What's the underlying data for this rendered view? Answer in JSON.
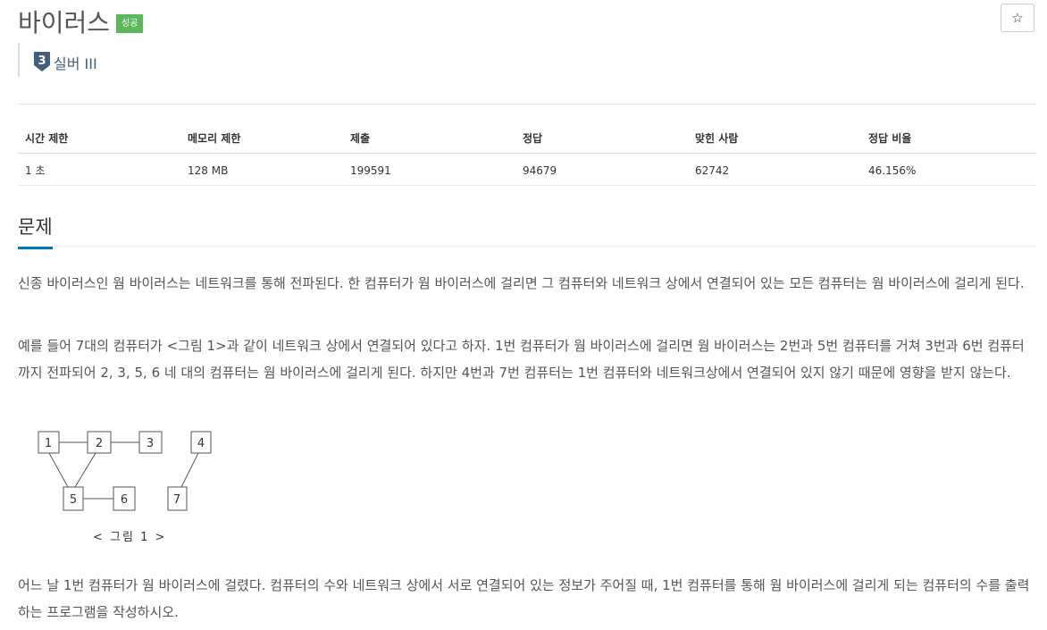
{
  "problem": {
    "title": "바이러스",
    "badge": "성공",
    "star": "☆",
    "tier_number": "3",
    "tier_label": "실버 III"
  },
  "info_table": {
    "headers": [
      "시간 제한",
      "메모리 제한",
      "제출",
      "정답",
      "맞힌 사람",
      "정답 비율"
    ],
    "values": [
      "1 초",
      "128 MB",
      "199591",
      "94679",
      "62742",
      "46.156%"
    ]
  },
  "section": {
    "title": "문제"
  },
  "paragraphs": [
    "신종 바이러스인 웜 바이러스는 네트워크를 통해 전파된다. 한 컴퓨터가 웜 바이러스에 걸리면 그 컴퓨터와 네트워크 상에서 연결되어 있는 모든 컴퓨터는 웜 바이러스에 걸리게 된다.",
    "예를 들어 7대의 컴퓨터가 <그림 1>과 같이 네트워크 상에서 연결되어 있다고 하자. 1번 컴퓨터가 웜 바이러스에 걸리면 웜 바이러스는 2번과 5번 컴퓨터를 거쳐 3번과 6번 컴퓨터까지 전파되어 2, 3, 5, 6 네 대의 컴퓨터는 웜 바이러스에 걸리게 된다. 하지만 4번과 7번 컴퓨터는 1번 컴퓨터와 네트워크상에서 연결되어 있지 않기 때문에 영향을 받지 않는다.",
    "어느 날 1번 컴퓨터가 웜 바이러스에 걸렸다. 컴퓨터의 수와 네트워크 상에서 서로 연결되어 있는 정보가 주어질 때, 1번 컴퓨터를 통해 웜 바이러스에 걸리게 되는 컴퓨터의 수를 출력하는 프로그램을 작성하시오."
  ],
  "figure": {
    "nodes": [
      "1",
      "2",
      "3",
      "4",
      "5",
      "6",
      "7"
    ],
    "caption": "< 그림 1 >"
  },
  "colors": {
    "badge_success": "#5cb85c",
    "tier_silver": "#435f7a",
    "section_underline": "#0076c0"
  }
}
